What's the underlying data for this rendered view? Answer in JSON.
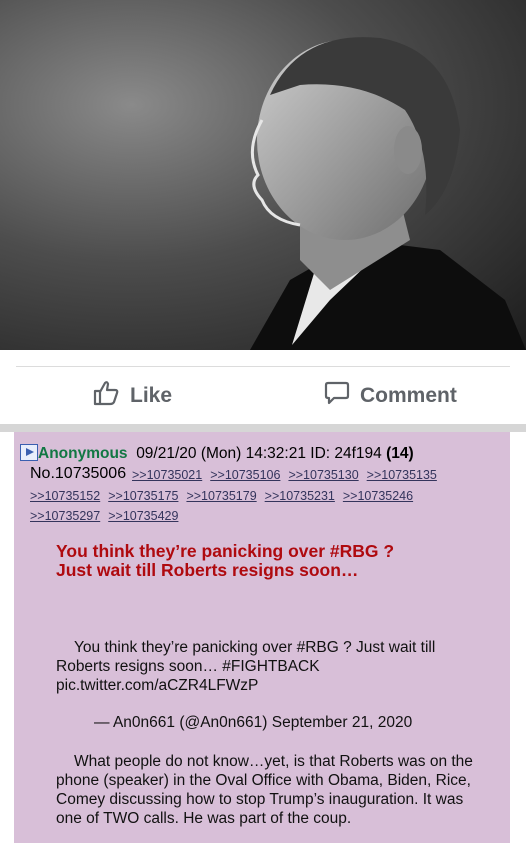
{
  "photo": {
    "alt": "black-and-white portrait",
    "icon": "portrait-photo"
  },
  "actions": {
    "like_label": "Like",
    "comment_label": "Comment"
  },
  "post": {
    "name": "Anonymous",
    "datetime": "09/21/20 (Mon) 14:32:21",
    "id_label": "ID: 24f194",
    "post_count": "(14)",
    "post_number": "No.10735006",
    "backlinks": [
      ">>10735021",
      ">>10735106",
      ">>10735130",
      ">>10735135",
      ">>10735152",
      ">>10735175",
      ">>10735179",
      ">>10735231",
      ">>10735246",
      ">>10735297",
      ">>10735429"
    ],
    "headline_line1": "You think they’re panicking over #RBG ?",
    "headline_line2": "Just wait till Roberts resigns soon…",
    "tweet_text": "You think they’re panicking over #RBG ? Just wait till Roberts resigns soon… #FIGHTBACK pic.twitter.com/aCZR4LFWzP",
    "tweet_attribution": "— An0n661 (@An0n661) September 21, 2020",
    "comment_text": "What people do not know…yet, is that Roberts was on the phone (speaker) in the Oval Office with Obama, Biden, Rice, Comey discussing how to stop Trump’s inauguration. It was one of TWO calls. He was part of the coup."
  },
  "colors": {
    "post_background": "#d8bfd8",
    "name_green": "#117743",
    "headline_red": "#af0a0f",
    "link_blue": "#34345c"
  }
}
